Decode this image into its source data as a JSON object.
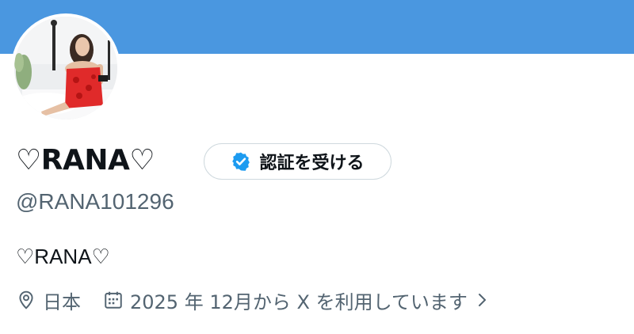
{
  "profile": {
    "display_name": "♡RANA♡",
    "handle": "@RANA101296",
    "bio": "♡RANA♡",
    "location": "日本",
    "joined": "2025 年 12月から X を利用しています",
    "verify_button_label": "認証を受ける"
  },
  "colors": {
    "banner": "#4a97e0",
    "verified_badge": "#1d9bf0",
    "secondary_text": "#536471",
    "primary_text": "#0f1419"
  },
  "icons": {
    "location": "location-pin-icon",
    "calendar": "calendar-icon",
    "chevron": "chevron-right-icon",
    "verified": "verified-badge-icon"
  }
}
